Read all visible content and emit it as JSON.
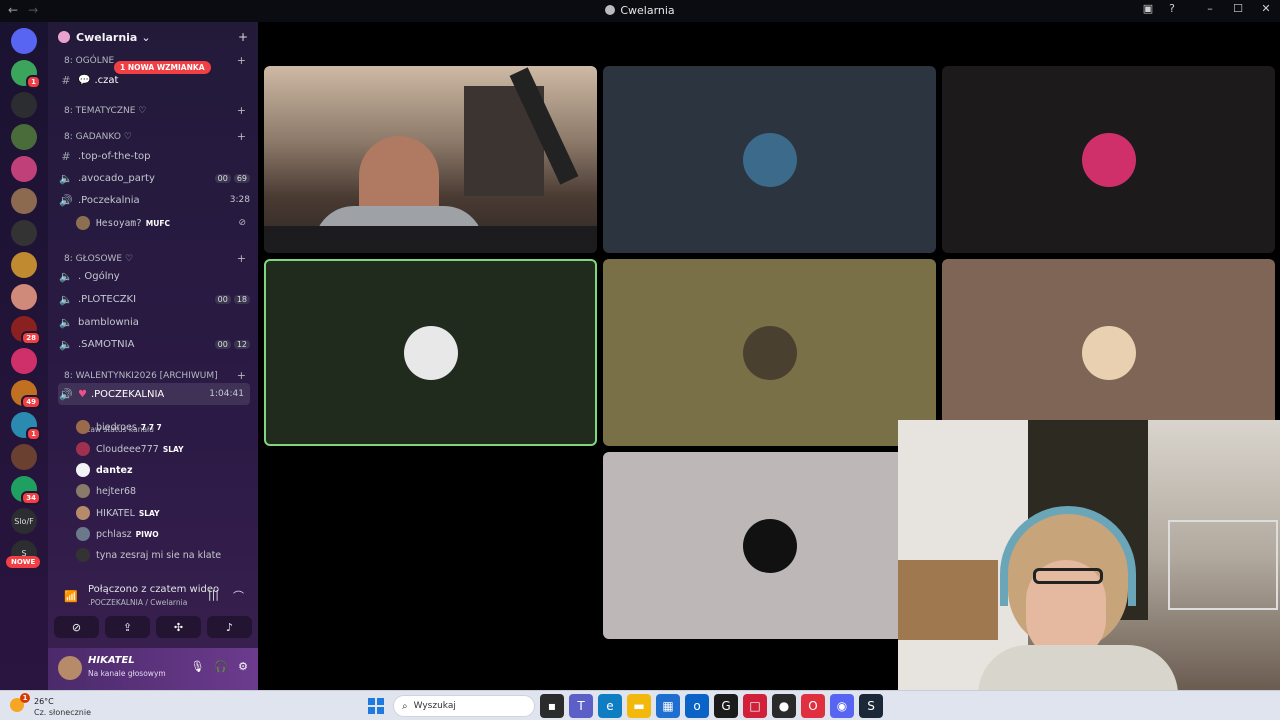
{
  "window": {
    "title": "Cwelarnia",
    "nav_back": "←",
    "nav_forward": "→",
    "inbox_icon": "▣",
    "help_icon": "?",
    "minimize": "–",
    "maximize": "☐",
    "close": "✕"
  },
  "rail": {
    "servers": [
      {
        "color": "#5865f2",
        "badge": ""
      },
      {
        "color": "#3ba55c",
        "badge": "1"
      },
      {
        "color": "#2b2d31",
        "badge": ""
      },
      {
        "color": "#4a6b3a",
        "badge": ""
      },
      {
        "color": "#c0407a",
        "badge": ""
      },
      {
        "color": "#8b6a50",
        "badge": ""
      },
      {
        "color": "#333333",
        "badge": ""
      },
      {
        "color": "#c08a30",
        "badge": ""
      },
      {
        "color": "#d08a7a",
        "badge": ""
      },
      {
        "color": "#8a2020",
        "badge": "28"
      },
      {
        "color": "#d0306a",
        "badge": ""
      },
      {
        "color": "#c07020",
        "badge": "49"
      },
      {
        "color": "#2a8ab0",
        "badge": "1"
      },
      {
        "color": "#6a4030",
        "badge": ""
      },
      {
        "color": "#20a060",
        "badge": "34"
      }
    ],
    "text_server": "Slo/F",
    "text_server2": "S",
    "new_label": "NOWE"
  },
  "guild": {
    "name": "Cwelarnia",
    "chevron": "⌄",
    "add_member_icon": "+"
  },
  "categories": {
    "ogolne": "8: OGÓLNE",
    "tematyczne": "8: TEMATYCZNE ♡",
    "gadanko": "8: GADANKO ♡",
    "glosowe": "8: GŁOSOWE ♡",
    "walentynki": "8: WALENTYNKI2026 [ARCHIWUM]",
    "plus": "+"
  },
  "mention_pill": "1 NOWA WZMIANKA",
  "channels": {
    "czat": ".czat",
    "top": ".top-of-the-top",
    "avocado": ".avocado_party",
    "avocado_a": "00",
    "avocado_b": "69",
    "poczekalnia_small": ".Poczekalnia",
    "poczekalnia_time": "3:28",
    "ogolny": ". Ogólny",
    "ploteczki": ".PLOTECZKI",
    "ploteczki_a": "00",
    "ploteczki_b": "18",
    "bamblownia": "bamblownia",
    "samotnia": ".SAMOTNIA",
    "samotnia_a": "00",
    "samotnia_b": "12",
    "poczekalnia_big": ".POCZEKALNIA",
    "poczekalnia_big_time": "1:04:41",
    "status_hint": "Ustaw status kanału"
  },
  "poczekalnia_member": {
    "name": "Hesoyam?",
    "tag": "MUFC"
  },
  "members": [
    {
      "name": "biedroes",
      "tag": "7 7 7",
      "bold": false,
      "color": "#9a6b4a"
    },
    {
      "name": "Cloudeee777",
      "tag": "SLAY",
      "bold": false,
      "color": "#a03050"
    },
    {
      "name": "dantez",
      "tag": "",
      "bold": true,
      "color": "#f2f3f5"
    },
    {
      "name": "hejter68",
      "tag": "",
      "bold": false,
      "color": "#8a7a6a"
    },
    {
      "name": "HIKATEL",
      "tag": "SLAY",
      "bold": false,
      "color": "#b58b6a"
    },
    {
      "name": "pchlasz",
      "tag": "PIWO",
      "bold": false,
      "color": "#6a7a8a"
    },
    {
      "name": "tyna zesraj mi sie na klate",
      "tag": "",
      "bold": false,
      "color": "#333333"
    }
  ],
  "voice": {
    "title": "Połączono z czatem wideo",
    "subtitle": ".POCZEKALNIA / Cwelarnia",
    "btn_camera": "⊘",
    "btn_screen": "⇪",
    "btn_activity": "✣",
    "btn_soundboard": "♪",
    "noise": "|||",
    "disconnect": "⌒"
  },
  "user": {
    "name": "HIKATEL",
    "status": "Na kanale głosowym",
    "mic_icon": "🎙",
    "headset_icon": "🎧",
    "settings_icon": "⚙"
  },
  "tiles": [
    {
      "kind": "camera",
      "bg": "#000000",
      "border": "none"
    },
    {
      "kind": "avatar",
      "bg": "#2c3440",
      "avatar_color": "#3b6a8a",
      "border": "none"
    },
    {
      "kind": "avatar",
      "bg": "#1d1a1b",
      "avatar_color": "#d0306a",
      "border": "none"
    },
    {
      "kind": "avatar",
      "bg": "#202b1e",
      "avatar_color": "#e8e8e8",
      "border": "2px solid #7ed67e"
    },
    {
      "kind": "avatar",
      "bg": "#797048",
      "avatar_color": "#4a4030",
      "border": "none"
    },
    {
      "kind": "avatar",
      "bg": "#7e6556",
      "avatar_color": "#e8d0b0",
      "border": "none"
    },
    {
      "kind": "avatar",
      "bg": "#bdb7b8",
      "avatar_color": "#111111",
      "border": "none"
    }
  ],
  "taskbar": {
    "temp": "26°C",
    "weather": "Cz. słonecznie",
    "weather_badge": "1",
    "search_placeholder": "Wyszukaj",
    "apps": [
      {
        "name": "task-view",
        "color": "#2b2b2b",
        "glyph": "▪"
      },
      {
        "name": "teams",
        "color": "#5b5fc7",
        "glyph": "T"
      },
      {
        "name": "edge",
        "color": "#0f7dc2",
        "glyph": "e"
      },
      {
        "name": "explorer",
        "color": "#f2b90c",
        "glyph": "▬"
      },
      {
        "name": "store",
        "color": "#1f6fd0",
        "glyph": "▦"
      },
      {
        "name": "outlook",
        "color": "#0a64c8",
        "glyph": "o"
      },
      {
        "name": "ea",
        "color": "#1b1b1b",
        "glyph": "G"
      },
      {
        "name": "app-red",
        "color": "#d0203a",
        "glyph": "□"
      },
      {
        "name": "app-dark",
        "color": "#2a2a2a",
        "glyph": "●"
      },
      {
        "name": "opera",
        "color": "#e03040",
        "glyph": "O"
      },
      {
        "name": "discord",
        "color": "#5865f2",
        "glyph": "◉"
      },
      {
        "name": "steam",
        "color": "#1b2838",
        "glyph": "S"
      }
    ]
  }
}
